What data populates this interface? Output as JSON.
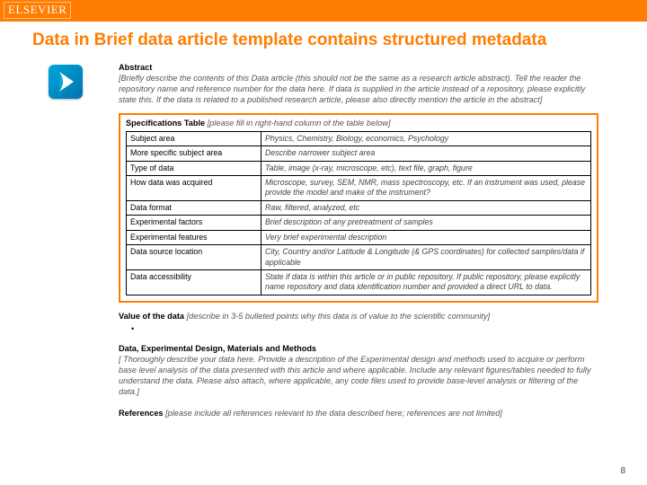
{
  "brand": "ELSEVIER",
  "title": "Data in Brief data article template contains structured metadata",
  "abstract": {
    "heading": "Abstract",
    "text": "[Briefly describe the contents of this Data article (this should not be the same as a research article abstract). Tell the reader the repository name and reference number for the data here. If data is supplied in the article instead of a repository, please explicitly state this. If the data is related to a published research article, please also directly mention the article in the abstract]"
  },
  "spec_heading_prefix": "Specifications Table ",
  "spec_heading_suffix": "[please fill in right-hand column of the table below]",
  "spec_rows": [
    {
      "label": "Subject area",
      "value": "Physics, Chemistry, Biology, economics, Psychology"
    },
    {
      "label": "More specific subject area",
      "value": "Describe narrower subject area"
    },
    {
      "label": "Type of data",
      "value": "Table, image (x-ray, microscope, etc), text file, graph, figure"
    },
    {
      "label": "How data was acquired",
      "value": "Microscope, survey, SEM, NMR, mass spectroscopy, etc. If an instrument was used, please provide the model and make of the instrument?"
    },
    {
      "label": "Data format",
      "value": "Raw, filtered, analyzed, etc"
    },
    {
      "label": "Experimental factors",
      "value": "Brief description of any pretreatment of samples"
    },
    {
      "label": "Experimental features",
      "value": "Very brief experimental description"
    },
    {
      "label": "Data source location",
      "value": "City, Country and/or Latitude & Longitude (& GPS coordinates) for collected samples/data if applicable"
    },
    {
      "label": "Data accessibility",
      "value": "State if data is within this article or in public repository. If public repository, please explicitly name repository and data identification number and provided a direct URL to data."
    }
  ],
  "value_heading_prefix": "Value of the data ",
  "value_heading_suffix": "[describe in 3-5 bulleted points why this data is of value to the scientific community]",
  "methods": {
    "heading": "Data, Experimental Design, Materials and Methods",
    "text": "[ Thoroughly describe your data here. Provide a description of the Experimental design and  methods used to acquire or perform base level analysis of the data presented with this article and where applicable. Include any relevant figures/tables needed to fully understand the data. Please also attach, where applicable, any code files used to provide base-level analysis or filtering of the data.]"
  },
  "refs_prefix": "References ",
  "refs_suffix": "[please include all references relevant to the data described here; references are not limited]",
  "pagenum": "8"
}
